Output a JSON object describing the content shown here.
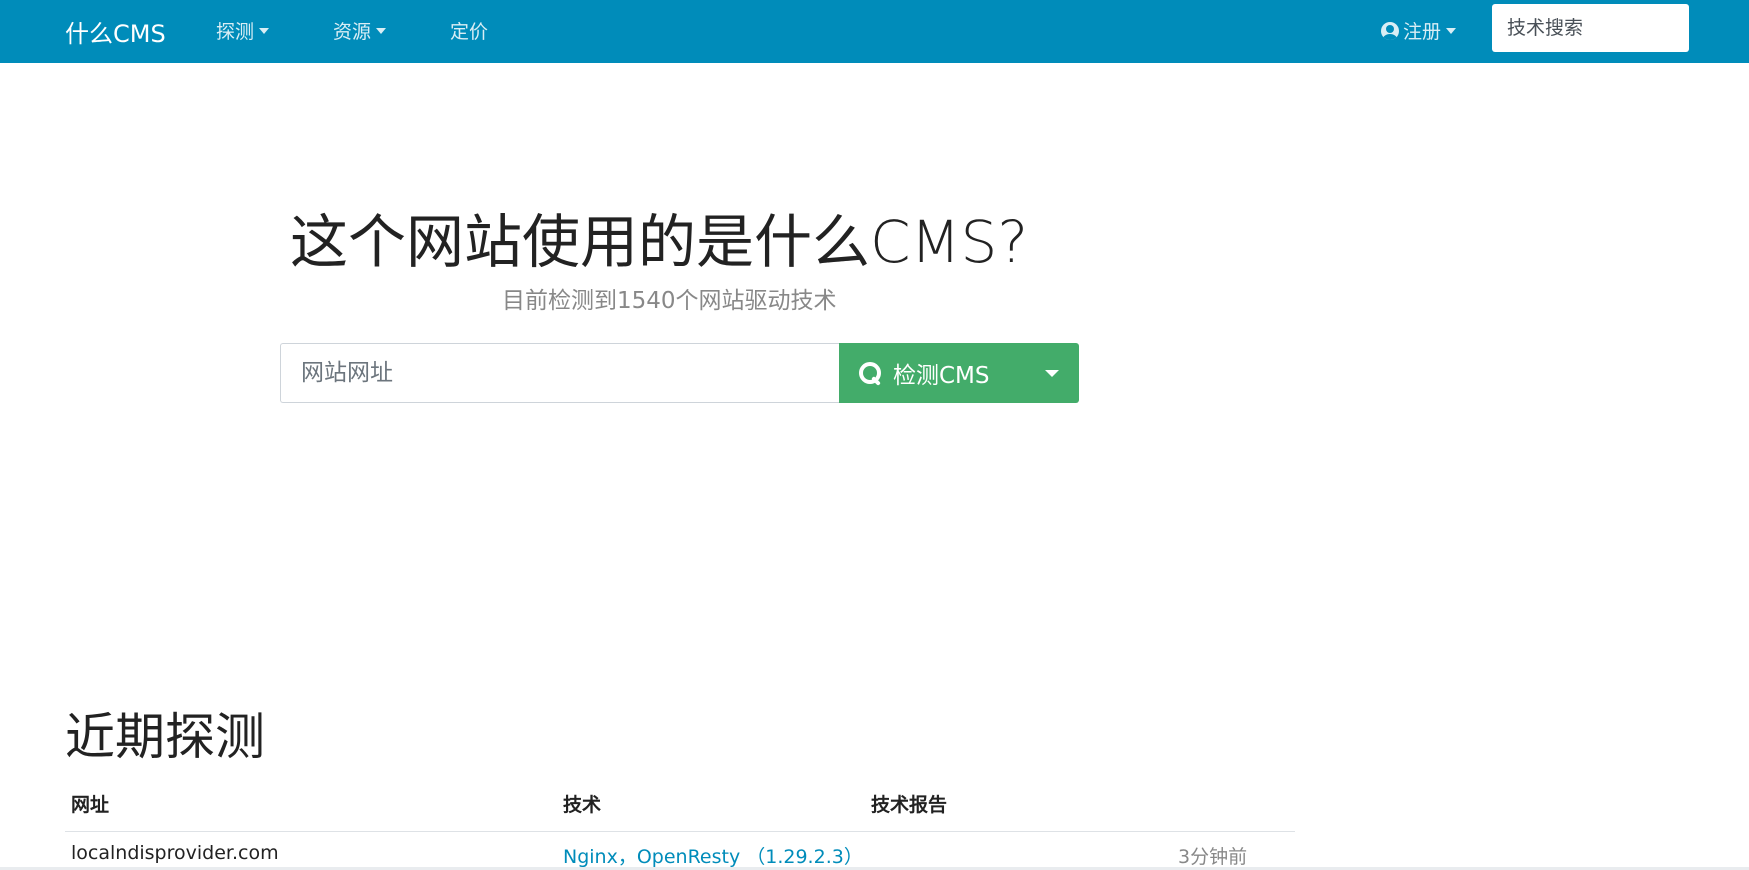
{
  "navbar": {
    "brand": "什么CMS",
    "items": [
      {
        "label": "探测",
        "has_dropdown": true
      },
      {
        "label": "资源",
        "has_dropdown": true
      },
      {
        "label": "定价",
        "has_dropdown": false
      }
    ],
    "account_label": "注册",
    "search_placeholder": "技术搜索"
  },
  "hero": {
    "title": "这个网站使用的是什么CMS?",
    "subtitle": "目前检测到1540个网站驱动技术",
    "input_placeholder": "网站网址",
    "button_label": "检测CMS"
  },
  "recent": {
    "title": "近期探测",
    "columns": [
      "网址",
      "技术",
      "技术报告"
    ],
    "rows": [
      {
        "url": "localndisprovider.com",
        "tech": "Nginx，OpenResty （1.29.2.3）",
        "time": "3分钟前"
      }
    ]
  },
  "colors": {
    "navbar": "#008cba",
    "button": "#43ac6a",
    "link": "#008cba"
  }
}
